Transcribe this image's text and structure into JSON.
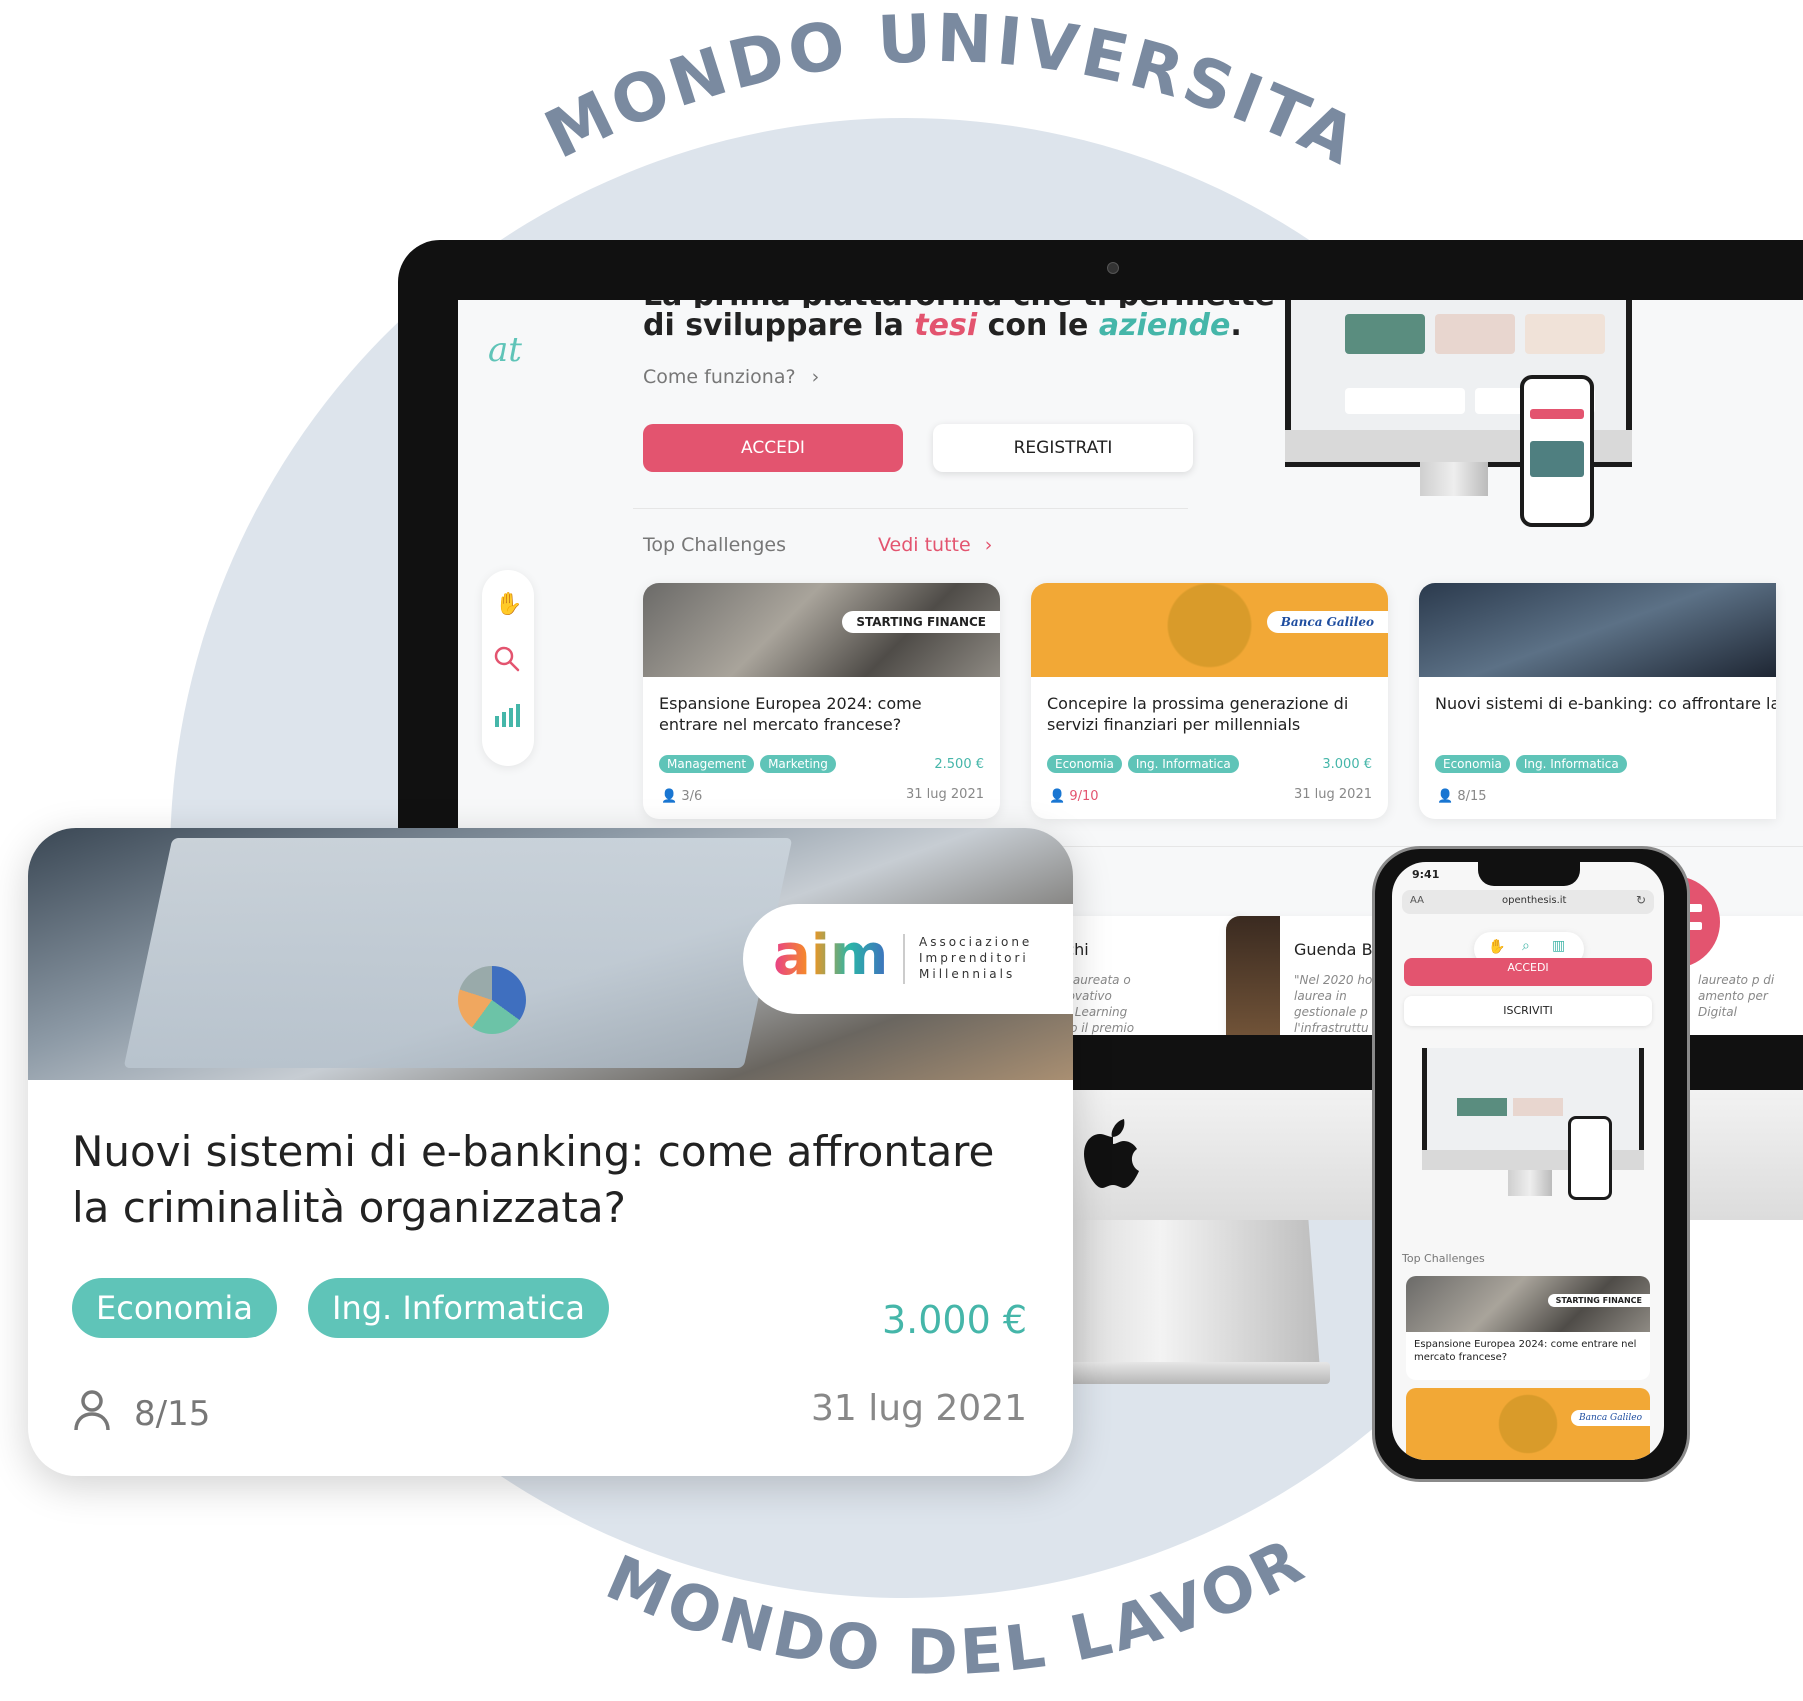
{
  "arc": {
    "top": "MONDO UNIVERSITARIO",
    "bottom": "MONDO DEL LAVORO"
  },
  "colors": {
    "accent_pink": "#e3546f",
    "accent_teal": "#5fc4b8",
    "arc_text": "#7a8aa0",
    "circle_bg": "#dde4ec"
  },
  "desktop": {
    "logo": "at",
    "hero": {
      "line_partial": "La prima piattaforma che ti permette",
      "line2_pre": "di sviluppare la ",
      "line2_tesi": "tesi",
      "line2_mid": "  con le ",
      "line2_aziende": "aziende",
      "line2_end": "."
    },
    "how_link": "Come funziona?",
    "btn_accedi": "ACCEDI",
    "btn_registrati": "REGISTRATI",
    "section_title": "Top Challenges",
    "see_all": "Vedi tutte",
    "side_icons": [
      "clap-icon",
      "search-icon",
      "stats-icon"
    ],
    "cards": [
      {
        "brand": "STARTING FINANCE",
        "title": "Espansione Europea 2024: come entrare nel mercato francese?",
        "tags": [
          "Management",
          "Marketing"
        ],
        "price": "2.500 €",
        "count": "3/6",
        "date": "31 lug 2021"
      },
      {
        "brand": "Banca Galileo",
        "title": "Concepire la prossima generazione di servizi finanziari per millennials",
        "tags": [
          "Economia",
          "Ing. Informatica"
        ],
        "price": "3.000 €",
        "count": "9/10",
        "date": "31 lug 2021"
      },
      {
        "brand": "",
        "title": "Nuovi sistemi di e-banking: co affrontare la criminalità organ",
        "tags": [
          "Economia",
          "Ing. Informatica"
        ],
        "price": "",
        "count": "8/15",
        "date": ""
      }
    ],
    "profiles": [
      {
        "name": "Bianchi",
        "quote": "i sono laureata o un innovativo lended Learning incendo il premio"
      },
      {
        "name": "Guenda B",
        "quote": "\"Nel 2020 ho mia laurea in gestionale p l'infrastruttu"
      },
      {
        "name": "",
        "quote": "laureato p di amento per Digital"
      }
    ]
  },
  "big_card": {
    "brand_logo": "aim",
    "brand_line1": "Associazione",
    "brand_line2": "Imprenditori",
    "brand_line3": "Millennials",
    "title": "Nuovi sistemi di e-banking: come affrontare la criminalità organizzata?",
    "tags": [
      "Economia",
      "Ing. Informatica"
    ],
    "price": "3.000 €",
    "count": "8/15",
    "date": "31 lug 2021"
  },
  "phone": {
    "time": "9:41",
    "url_left": "AA",
    "url": "openthesis.it",
    "btn_accedi": "ACCEDI",
    "btn_iscriviti": "ISCRIVITI",
    "section_title": "Top Challenges",
    "card_brand": "STARTING FINANCE",
    "card_title": "Espansione Europea 2024: come entrare nel mercato francese?",
    "card2_brand": "Banca Galileo"
  }
}
